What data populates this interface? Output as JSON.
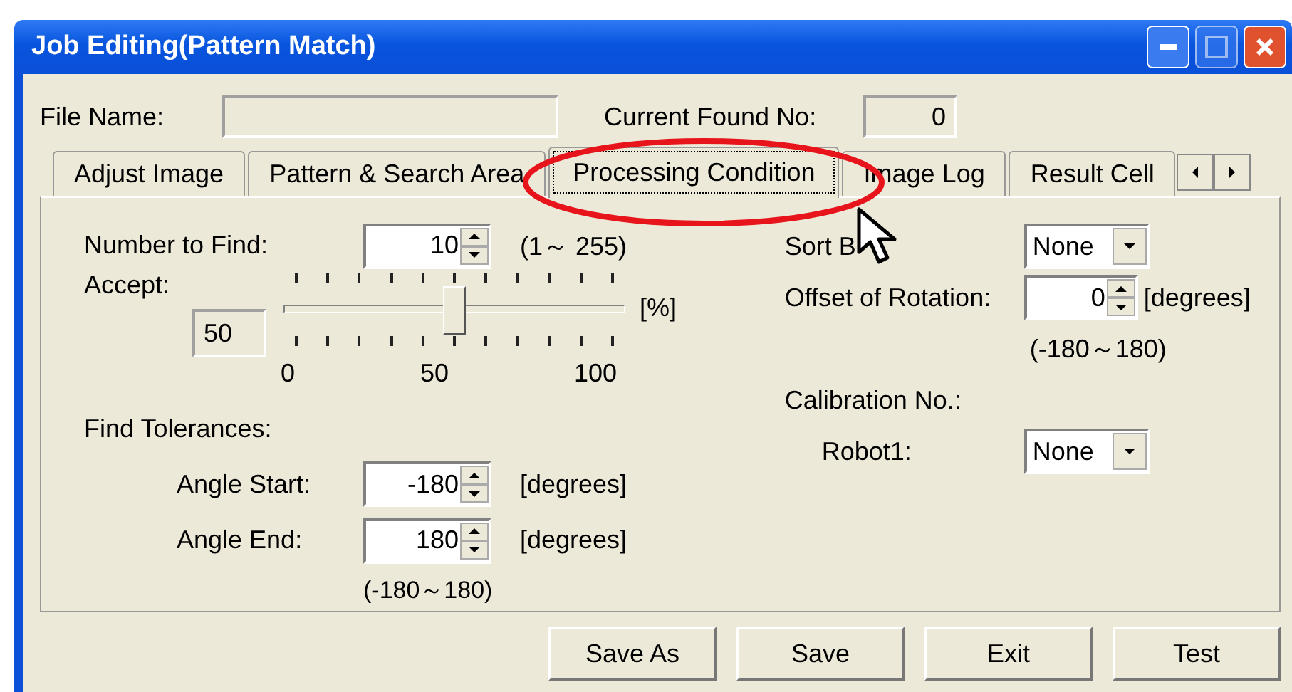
{
  "window": {
    "title": "Job Editing(Pattern Match)"
  },
  "header": {
    "file_name": {
      "label": "File Name:"
    },
    "current_found": {
      "label": "Current Found No:",
      "value": "0"
    }
  },
  "tabs": [
    {
      "label": "Adjust Image",
      "selected": false
    },
    {
      "label": "Pattern & Search Area",
      "selected": false
    },
    {
      "label": "Processing Condition",
      "selected": true
    },
    {
      "label": "Image Log",
      "selected": false
    },
    {
      "label": "Result Cell",
      "selected": false
    }
  ],
  "number_to_find": {
    "label": "Number to Find:",
    "value": "10",
    "range": "(1～ 255)"
  },
  "accept": {
    "label": "Accept:",
    "value": "50",
    "level": 0.5,
    "unit": "[%]",
    "scale": [
      "0",
      "50",
      "100"
    ]
  },
  "find_tolerances": {
    "label": "Find Tolerances:",
    "rows": [
      {
        "label": "Angle Start:",
        "value": "-180",
        "unit": "[degrees]"
      },
      {
        "label": "Angle End:",
        "value": "180",
        "unit": "[degrees]"
      }
    ],
    "range": "(-180～180)"
  },
  "sort_by": {
    "label": "Sort B",
    "value": "None"
  },
  "offset_of_rotation": {
    "label": "Offset of Rotation:",
    "value": "0",
    "unit": "[degrees]",
    "range": "(-180～180)"
  },
  "calibration": {
    "label": "Calibration No.:",
    "rows": [
      {
        "label": "Robot1:",
        "value": "None"
      }
    ]
  },
  "buttons": [
    {
      "label": "Save As"
    },
    {
      "label": "Save"
    },
    {
      "label": "Exit"
    },
    {
      "label": "Test"
    }
  ]
}
